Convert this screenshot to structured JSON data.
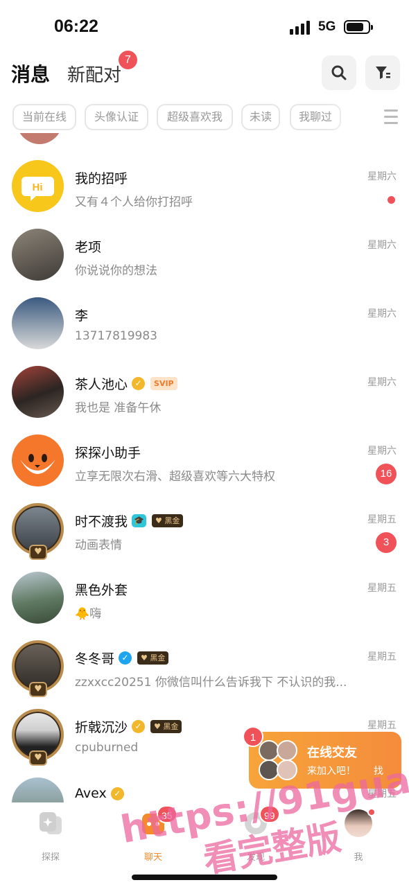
{
  "status_bar": {
    "time": "06:22",
    "network": "5G"
  },
  "header": {
    "tab_messages": "消息",
    "tab_new_match": "新配对",
    "new_match_count": "7",
    "search_icon": "search-icon",
    "filter_icon": "filter-icon"
  },
  "filters": [
    "当前在线",
    "头像认证",
    "超级喜欢我",
    "未读",
    "我聊过"
  ],
  "conversations": [
    {
      "name": "我的招呼",
      "preview": "又有４个人给你打招呼",
      "time": "星期六",
      "unread_dot": true,
      "avatar_color": "#f7c71c"
    },
    {
      "name": "老项",
      "preview": "你说说你的想法",
      "time": "星期六",
      "avatar_color": "#6c6a66"
    },
    {
      "name": "李",
      "preview": "13717819983",
      "time": "星期六",
      "avatar_color": "#5b6f86"
    },
    {
      "name": "茶人池心",
      "preview": "我也是 准备午休",
      "time": "星期六",
      "verified": true,
      "tag": "SVIP",
      "avatar_color": "#3f3a36"
    },
    {
      "name": "探探小助手",
      "preview": "立享无限次右滑、超级喜欢等六大特权",
      "time": "星期六",
      "unread_count": "16",
      "avatar_color": "#f5772b"
    },
    {
      "name": "时不渡我",
      "preview": "动画表情",
      "time": "星期五",
      "edu": true,
      "tag": "黑金",
      "unread_count": "3",
      "avatar_color": "#4f5560"
    },
    {
      "name": "黑色外套",
      "preview": "嗨",
      "preview_emoji": "🐥",
      "time": "星期五",
      "avatar_color": "#5f7a63"
    },
    {
      "name": "冬冬哥",
      "preview": "zzxxcc20251 你微信叫什么告诉我下 不认识的我...",
      "time": "星期五",
      "verified_blue": true,
      "tag": "黑金",
      "avatar_color": "#56504a"
    },
    {
      "name": "折戟沉沙",
      "preview": "cpuburned",
      "time": "星期五",
      "verified": true,
      "tag": "黑金",
      "avatar_color": "#e4e4e4"
    },
    {
      "name": "Avex",
      "preview": "",
      "time": "星期五",
      "verified": true,
      "avatar_color": "#8aa3b5"
    }
  ],
  "online_card": {
    "count": "1",
    "title": "在线交友",
    "subtitle": "来加入吧！",
    "trail": "找"
  },
  "tabbar": {
    "tabs": [
      {
        "label": "探探",
        "icon": "cards-icon"
      },
      {
        "label": "聊天",
        "icon": "chat-icon",
        "badge": "35",
        "active": true
      },
      {
        "label": "发现",
        "icon": "discover-icon",
        "badge": "99"
      },
      {
        "label": "我",
        "icon": "profile-avatar-icon"
      }
    ]
  },
  "watermark": {
    "line1": "https://91gua12.com",
    "line2": "看完整版"
  },
  "colors": {
    "accent": "#f48a2c",
    "badge_red": "#f0525a",
    "svip": "#ef7a2b",
    "black_gold": "#3b2b19"
  }
}
